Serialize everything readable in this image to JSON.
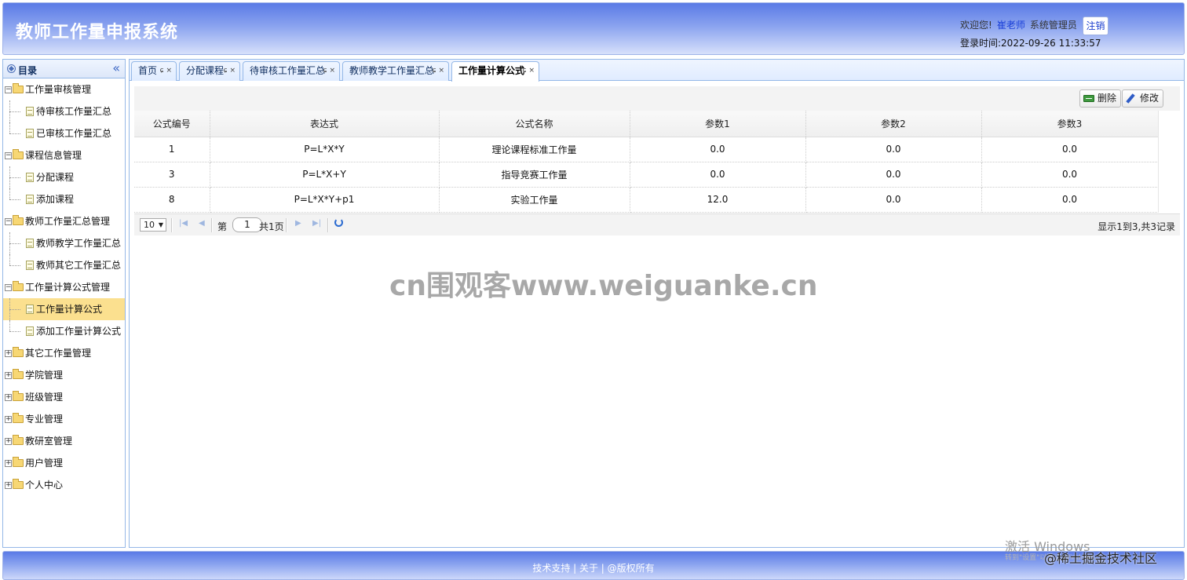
{
  "header": {
    "title": "教师工作量申报系统",
    "welcome": "欢迎您!",
    "user_name": "崔老师",
    "role": "系统管理员",
    "logout_label": "注销",
    "login_time": "登录时间:2022-09-26 11:33:57"
  },
  "sidebar": {
    "title": "目录",
    "collapse_glyph": "«",
    "groups": [
      {
        "label": "工作量审核管理",
        "expanded": true,
        "children": [
          "待审核工作量汇总",
          "已审核工作量汇总"
        ]
      },
      {
        "label": "课程信息管理",
        "expanded": true,
        "children": [
          "分配课程",
          "添加课程"
        ]
      },
      {
        "label": "教师工作量汇总管理",
        "expanded": true,
        "children": [
          "教师教学工作量汇总",
          "教师其它工作量汇总"
        ]
      },
      {
        "label": "工作量计算公式管理",
        "expanded": true,
        "children": [
          "工作量计算公式",
          "添加工作量计算公式"
        ]
      },
      {
        "label": "其它工作量管理",
        "expanded": false,
        "children": []
      },
      {
        "label": "学院管理",
        "expanded": false,
        "children": []
      },
      {
        "label": "班级管理",
        "expanded": false,
        "children": []
      },
      {
        "label": "专业管理",
        "expanded": false,
        "children": []
      },
      {
        "label": "教研室管理",
        "expanded": false,
        "children": []
      },
      {
        "label": "用户管理",
        "expanded": false,
        "children": []
      },
      {
        "label": "个人中心",
        "expanded": false,
        "children": []
      }
    ],
    "selected_item": "工作量计算公式"
  },
  "tabs": [
    {
      "label": "首页"
    },
    {
      "label": "分配课程"
    },
    {
      "label": "待审核工作量汇总"
    },
    {
      "label": "教师教学工作量汇总"
    },
    {
      "label": "工作量计算公式"
    }
  ],
  "tab_controls": "ɕ ×",
  "toolbar": {
    "delete_label": "删除",
    "edit_label": "修改"
  },
  "grid": {
    "columns": [
      "公式编号",
      "表达式",
      "公式名称",
      "参数1",
      "参数2",
      "参数3"
    ],
    "rows": [
      [
        "1",
        "P=L*X*Y",
        "理论课程标准工作量",
        "0.0",
        "0.0",
        "0.0"
      ],
      [
        "3",
        "P=L*X+Y",
        "指导竞赛工作量",
        "0.0",
        "0.0",
        "0.0"
      ],
      [
        "8",
        "P=L*X*Y+p1",
        "实验工作量",
        "12.0",
        "0.0",
        "0.0"
      ]
    ]
  },
  "pager": {
    "page_size": "10",
    "page_prefix": "第",
    "page_value": "1",
    "page_suffix": "共1页",
    "summary": "显示1到3,共3记录"
  },
  "watermark": "cn围观客www.weiguanke.cn",
  "footer": {
    "links": "技术支持 | 关于 | @版权所有"
  },
  "overlay": {
    "activate": "激活 Windows",
    "activate_sub": "转到\"设置\"以激活 Windows。",
    "juejin": "@稀土掘金技术社区"
  }
}
